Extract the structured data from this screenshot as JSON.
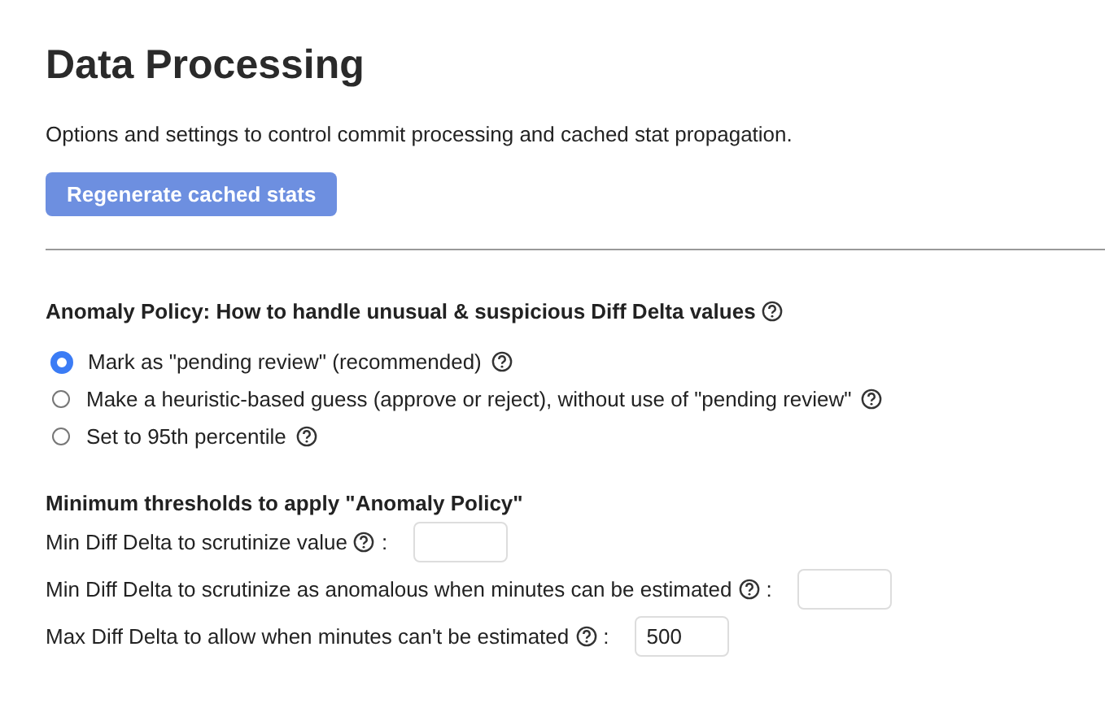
{
  "title": "Data Processing",
  "description": "Options and settings to control commit processing and cached stat propagation.",
  "regenerate_button": "Regenerate cached stats",
  "anomaly_policy": {
    "heading": "Anomaly Policy: How to handle unusual & suspicious Diff Delta values",
    "options": [
      {
        "label": "Mark as \"pending review\" (recommended)",
        "selected": true
      },
      {
        "label": "Make a heuristic-based guess (approve or reject), without use of \"pending review\"",
        "selected": false
      },
      {
        "label": "Set to 95th percentile",
        "selected": false
      }
    ]
  },
  "thresholds": {
    "heading": "Minimum thresholds to apply \"Anomaly Policy\"",
    "fields": [
      {
        "label": "Min Diff Delta to scrutinize value",
        "separator": ":"
      },
      {
        "label": "Min Diff Delta to scrutinize as anomalous when minutes can be estimated",
        "separator": ":"
      },
      {
        "label": "Max Diff Delta to allow when minutes can't be estimated",
        "separator": ":",
        "value": "500"
      }
    ]
  }
}
